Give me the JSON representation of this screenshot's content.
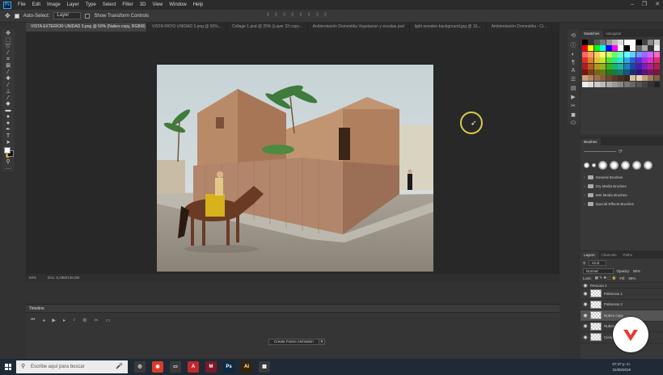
{
  "menu": [
    "File",
    "Edit",
    "Image",
    "Layer",
    "Type",
    "Select",
    "Filter",
    "3D",
    "View",
    "Window",
    "Help"
  ],
  "window_controls": [
    "–",
    "❐",
    "✕"
  ],
  "options_bar": {
    "auto_select_label": "Auto-Select:",
    "auto_select_value": "Layer",
    "transform_label": "Show Transform Controls"
  },
  "tabs": [
    "VISTA EXTERIOR UNIDAD 3.png @ 50% (Nubes copy, RGB/8) *",
    "VISTA PATIO UNIDAD 3.png @ 50%...",
    "Collage 1.psd @ 25% (Layer 33 copy...",
    "Ambientación Domestika Vegetacion y escalas.psd",
    "light-wooden-background.jpg @ 16...",
    "Ambientación Domestika - Ci..."
  ],
  "status": {
    "zoom": "50%",
    "doc": "Doc: 5,49M/136,0M"
  },
  "timeline": {
    "title": "Timeline",
    "create_button": "Create Frame Animation"
  },
  "panels": {
    "swatches_tab": "Swatches",
    "navigator_tab": "Navigator",
    "brushes_title": "Brushes",
    "brush_folders": [
      "General Brushes",
      "Dry Media Brushes",
      "Wet Media Brushes",
      "Special Effects Brushes"
    ],
    "layers_tabs": [
      "Layers",
      "Channels",
      "Paths"
    ],
    "kind_label": "Kind",
    "blend_mode": "Normal",
    "opacity_label": "Opacity:",
    "opacity_value": "95%",
    "lock_label": "Lock:",
    "fill_label": "Fill:",
    "fill_value": "95%",
    "layers": [
      {
        "name": "Palmeras 1",
        "selected": false
      },
      {
        "name": "Palmeras 2",
        "selected": false
      },
      {
        "name": "Nubes copy",
        "selected": true
      },
      {
        "name": "Nubes",
        "selected": false
      },
      {
        "name": "Cielo",
        "selected": false
      }
    ],
    "layers_top_partial": "Persona 1"
  },
  "taskbar": {
    "search_placeholder": "Escribe aquí para buscar",
    "time": "07:37 p. m.",
    "date": "31/05/2019",
    "apps": [
      {
        "label": "◎",
        "color": "#3a3a3a"
      },
      {
        "label": "◉",
        "color": "#d93b2b"
      },
      {
        "label": "▭",
        "color": "#3a3a3a"
      },
      {
        "label": "A",
        "color": "#c0282a"
      },
      {
        "label": "M",
        "color": "#7a1a2a"
      },
      {
        "label": "Ps",
        "color": "#0b2a47"
      },
      {
        "label": "Ai",
        "color": "#3a2400"
      },
      {
        "label": "▦",
        "color": "#3a3a3a"
      }
    ]
  }
}
